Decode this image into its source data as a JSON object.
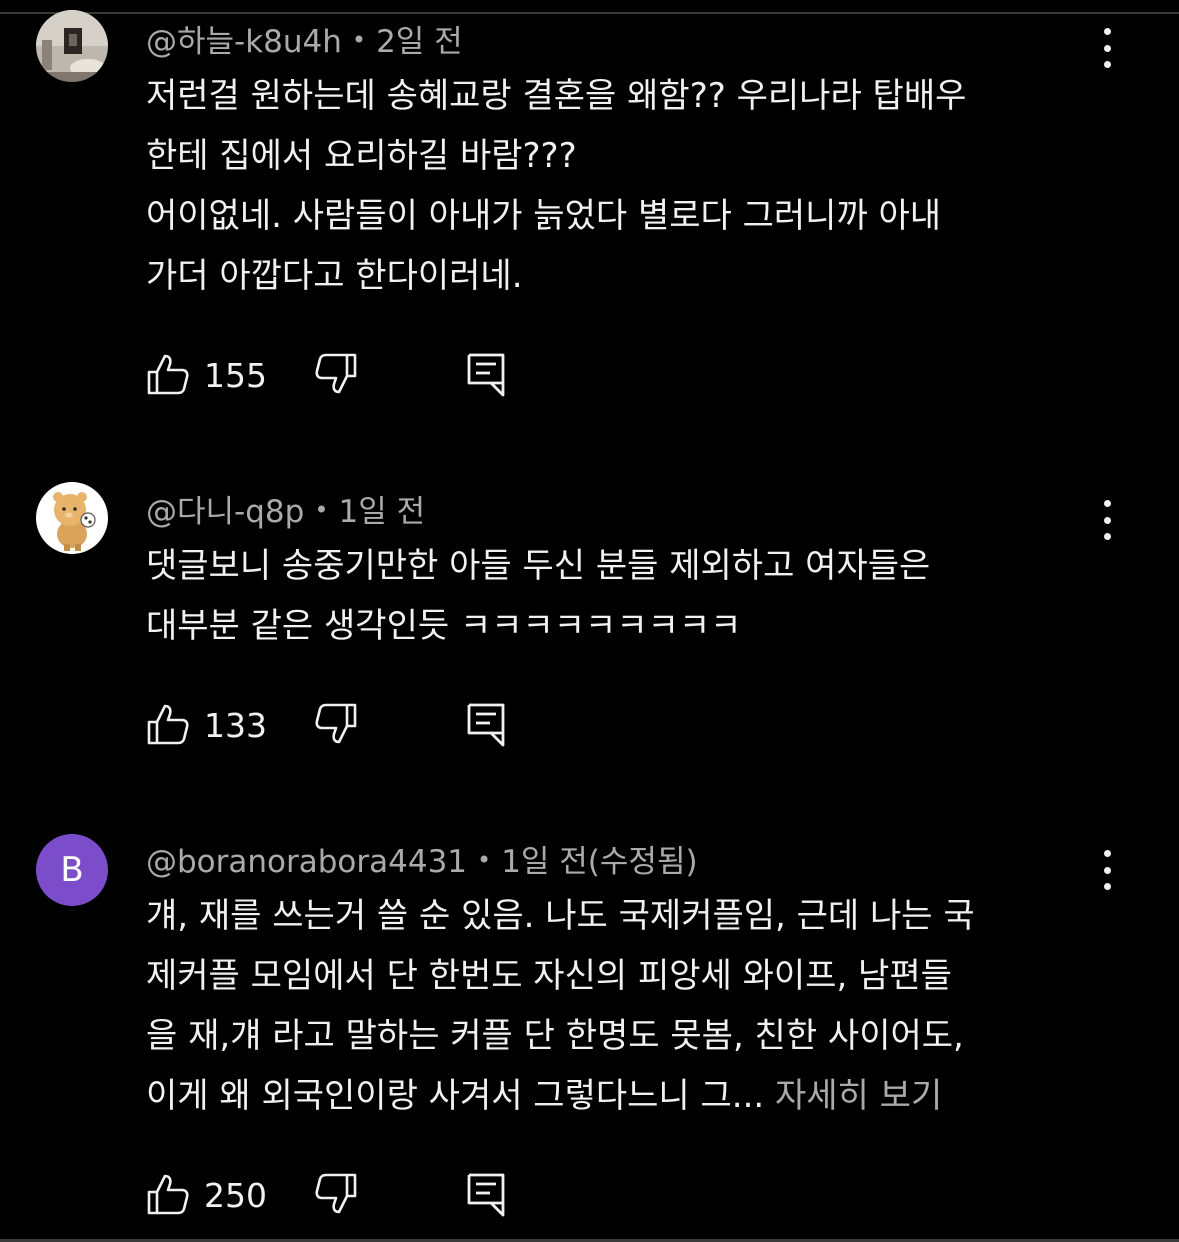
{
  "comments": [
    {
      "author": "@하늘-k8u4h",
      "time": "2일 전",
      "text": "저런걸 원하는데 송혜교랑 결혼을 왜함?? 우리나라 탑배우\n한테 집에서 요리하길 바람???\n어이없네. 사람들이 아내가 늙었다 별로다 그러니까 아내\n가더 아깝다고 한다이러네.",
      "more": "",
      "likes": "155",
      "avatar": {
        "type": "photo",
        "icon": "room-photo-avatar"
      }
    },
    {
      "author": "@다니-q8p",
      "time": "1일 전",
      "text": "댓글보니 송중기만한 아들 두신 분들 제외하고 여자들은\n대부분 같은 생각인듯 ㅋㅋㅋㅋㅋㅋㅋㅋㅋ",
      "more": "",
      "likes": "133",
      "avatar": {
        "type": "illustration",
        "icon": "bear-character-avatar"
      }
    },
    {
      "author": "@boranorabora4431",
      "time": "1일 전(수정됨)",
      "text": "걔, 재를 쓰는거 쓸 순 있음. 나도 국제커플임, 근데 나는 국\n제커플 모임에서 단 한번도 자신의 피앙세 와이프, 남편들\n을 재,걔 라고 말하는 커플 단 한명도 못봄, 친한 사이어도,\n이게 왜 외국인이랑 사겨서 그렇다느니 그... ",
      "more": "자세히 보기",
      "likes": "250",
      "avatar": {
        "type": "letter",
        "letter": "B",
        "color": "#7c4dcb"
      }
    }
  ],
  "colors": {
    "background": "#000000",
    "text": "#f1f1f1",
    "meta": "#aaaaaa",
    "avatar_purple": "#7c4dcb"
  },
  "icons": {
    "like": "thumbs-up-icon",
    "dislike": "thumbs-down-icon",
    "reply": "reply-comment-icon",
    "menu": "more-vertical-icon"
  }
}
